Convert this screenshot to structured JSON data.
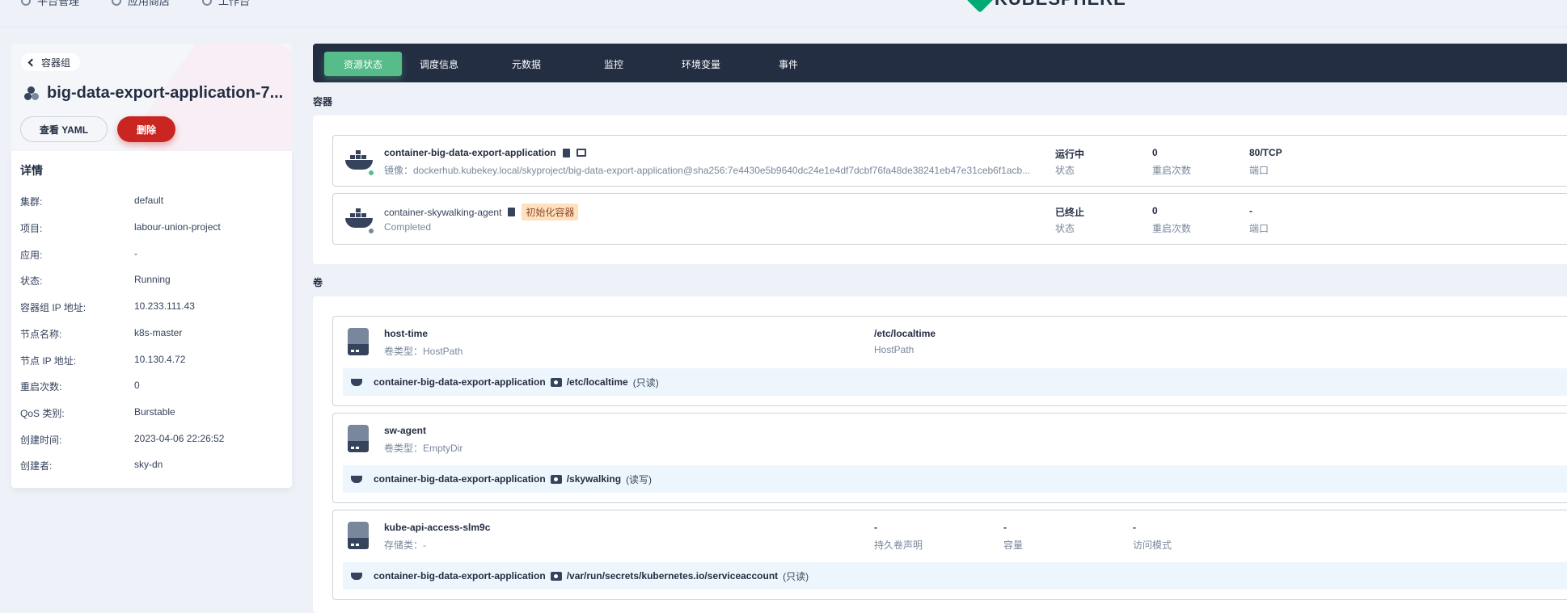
{
  "topnav": {
    "items": [
      {
        "label": "平台管理",
        "icon": "gear-icon"
      },
      {
        "label": "应用商店",
        "icon": "store-icon"
      },
      {
        "label": "工作台",
        "icon": "dashboard-icon"
      }
    ],
    "logo": "KUBESPHERE"
  },
  "header": {
    "back_label": "容器组",
    "pod_name": "big-data-export-application-7...",
    "yaml_button": "查看 YAML",
    "delete_button": "删除"
  },
  "details": {
    "title": "详情",
    "rows": [
      {
        "key": "集群:",
        "value": "default"
      },
      {
        "key": "项目:",
        "value": "labour-union-project"
      },
      {
        "key": "应用:",
        "value": "-"
      },
      {
        "key": "状态:",
        "value": "Running"
      },
      {
        "key": "容器组 IP 地址:",
        "value": "10.233.111.43"
      },
      {
        "key": "节点名称:",
        "value": "k8s-master"
      },
      {
        "key": "节点 IP 地址:",
        "value": "10.130.4.72"
      },
      {
        "key": "重启次数:",
        "value": "0"
      },
      {
        "key": "QoS 类别:",
        "value": "Burstable"
      },
      {
        "key": "创建时间:",
        "value": "2023-04-06 22:26:52"
      },
      {
        "key": "创建者:",
        "value": "sky-dn"
      }
    ]
  },
  "tabs": [
    {
      "label": "资源状态",
      "active": true
    },
    {
      "label": "调度信息"
    },
    {
      "label": "元数据"
    },
    {
      "label": "监控"
    },
    {
      "label": "环境变量"
    },
    {
      "label": "事件"
    }
  ],
  "containers": {
    "section_label": "容器",
    "items": [
      {
        "name": "container-big-data-export-application",
        "sub": "镜像：dockerhub.kubekey.local/skyproject/big-data-export-application@sha256:7e4430e5b9640dc24e1e4df7dcbf76fa48de38241eb47e31ceb6f1acb...",
        "status_value": "运行中",
        "status_label": "状态",
        "restarts_value": "0",
        "restarts_label": "重启次数",
        "port_value": "80/TCP",
        "port_label": "端口",
        "status_color": "#55bc8a"
      },
      {
        "name": "container-skywalking-agent",
        "tag": "初始化容器",
        "sub": "Completed",
        "status_value": "已终止",
        "status_label": "状态",
        "restarts_value": "0",
        "restarts_label": "重启次数",
        "port_value": "-",
        "port_label": "端口",
        "status_color": "#79879c"
      }
    ]
  },
  "volumes": {
    "section_label": "卷",
    "items": [
      {
        "name": "host-time",
        "type": "卷类型：HostPath",
        "col1_value": "/etc/localtime",
        "col1_label": "HostPath",
        "mount_container": "container-big-data-export-application",
        "mount_path": "/etc/localtime",
        "mount_mode": "(只读)"
      },
      {
        "name": "sw-agent",
        "type": "卷类型：EmptyDir",
        "mount_container": "container-big-data-export-application",
        "mount_path": "/skywalking",
        "mount_mode": "(读写)"
      },
      {
        "name": "kube-api-access-slm9c",
        "type": "存储类：-",
        "col1_value": "-",
        "col1_label": "持久卷声明",
        "col2_value": "-",
        "col2_label": "容量",
        "col3_value": "-",
        "col3_label": "访问模式",
        "mount_container": "container-big-data-export-application",
        "mount_path": "/var/run/secrets/kubernetes.io/serviceaccount",
        "mount_mode": "(只读)"
      }
    ]
  }
}
